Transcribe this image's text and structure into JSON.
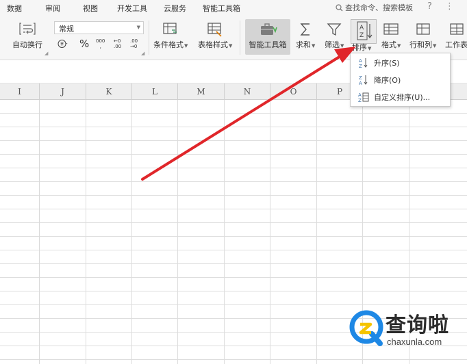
{
  "menu": {
    "tabs": [
      "数据",
      "审阅",
      "视图",
      "开发工具",
      "云服务",
      "智能工具箱"
    ],
    "search_label": "查找命令、搜索模板",
    "help_icon": "question-icon",
    "more_icon": "more-icon"
  },
  "ribbon": {
    "wrap_text_label": "自动换行",
    "number_format_value": "常规",
    "number_icons": [
      "currency-icon",
      "percent-icon",
      "thousands-separator-icon",
      "increase-decimal-icon",
      "decrease-decimal-icon"
    ],
    "percent_symbol": "%",
    "thousands_glyph": "000",
    "inc_decimal_glyph": "←0 .00",
    "dec_decimal_glyph": ".00 →0",
    "conditional_format_label": "条件格式",
    "table_style_label": "表格样式",
    "smart_tools_label": "智能工具箱",
    "sum_label": "求和",
    "filter_label": "筛选",
    "sort_label": "排序",
    "format_label": "格式",
    "rows_cols_label": "行和列",
    "worksheet_label": "工作表"
  },
  "sort_menu": {
    "items": [
      {
        "label": "升序(S)",
        "icon": "sort-ascending-icon"
      },
      {
        "label": "降序(O)",
        "icon": "sort-descending-icon"
      },
      {
        "label": "自定义排序(U)...",
        "icon": "custom-sort-icon"
      }
    ]
  },
  "grid": {
    "columns": [
      "I",
      "J",
      "K",
      "L",
      "M",
      "N",
      "O",
      "P"
    ]
  },
  "colors": {
    "arrow": "#e0262a",
    "watermark_blue": "#1e88e5",
    "watermark_yellow": "#f5c400"
  },
  "watermark": {
    "title": "查询啦",
    "domain": "chaxunla.com"
  }
}
